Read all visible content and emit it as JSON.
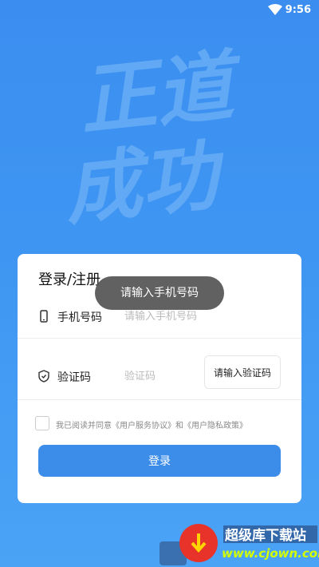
{
  "status_bar": {
    "time": "9:56",
    "wifi_icon": "wifi-icon"
  },
  "hero": {
    "lines": [
      "正道",
      "成功"
    ]
  },
  "login": {
    "title": "登录/注册",
    "phone_label": "手机号码",
    "phone_placeholder": "请输入手机号码",
    "code_label": "验证码",
    "code_placeholder": "验证码",
    "send_code_button": "请输入验证码",
    "agreement_text": "我已阅读并同意《用户服务协议》和《用户隐私政策》",
    "login_button": "登录"
  },
  "toast": {
    "message": "请输入手机号码"
  },
  "watermark": {
    "text": "www.cjown.com",
    "brand": "超级库下载站"
  },
  "colors": {
    "accent": "#3c8de9",
    "background": "#3f96f2"
  }
}
